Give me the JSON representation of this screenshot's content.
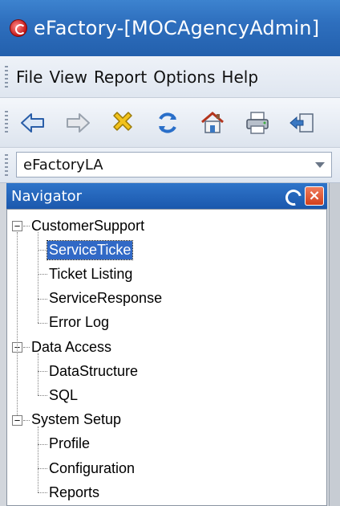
{
  "window": {
    "title": "eFactory-[MOCAgencyAdmin]"
  },
  "menu": {
    "items": [
      "File",
      "View",
      "Report",
      "Options",
      "Help"
    ]
  },
  "toolbar": {
    "buttons": [
      "back-arrow-icon",
      "forward-arrow-icon",
      "delete-x-icon",
      "refresh-icon",
      "home-icon",
      "print-icon",
      "import-icon"
    ]
  },
  "combo": {
    "value": "eFactoryLA"
  },
  "navigator": {
    "title": "Navigator",
    "tree": [
      {
        "label": "CustomerSupport",
        "expanded": true,
        "children": [
          {
            "label": "ServiceTicke",
            "selected": true
          },
          {
            "label": "Ticket Listing"
          },
          {
            "label": "ServiceResponse"
          },
          {
            "label": "Error Log"
          }
        ]
      },
      {
        "label": "Data Access",
        "expanded": true,
        "children": [
          {
            "label": "DataStructure"
          },
          {
            "label": "SQL"
          }
        ]
      },
      {
        "label": "System Setup",
        "expanded": true,
        "children": [
          {
            "label": "Profile"
          },
          {
            "label": "Configuration"
          },
          {
            "label": "Reports"
          }
        ]
      }
    ]
  },
  "colors": {
    "title_bar": "#2e6fbe",
    "selection": "#3169c6",
    "close_button": "#d2401c"
  }
}
